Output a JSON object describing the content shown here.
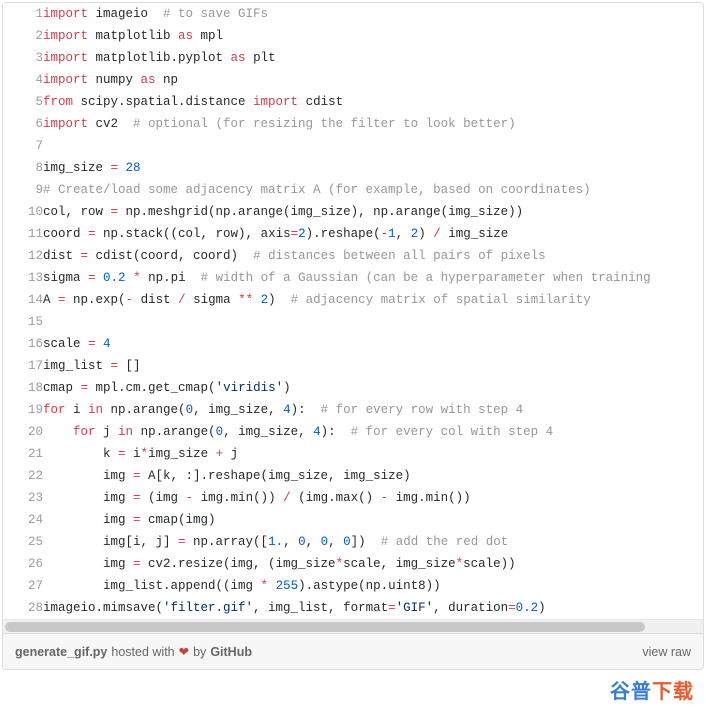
{
  "lines": [
    {
      "n": 1,
      "tokens": [
        [
          "kw",
          "import"
        ],
        [
          "pl",
          " imageio  "
        ],
        [
          "cm",
          "# to save GIFs"
        ]
      ]
    },
    {
      "n": 2,
      "tokens": [
        [
          "kw",
          "import"
        ],
        [
          "pl",
          " matplotlib "
        ],
        [
          "kw",
          "as"
        ],
        [
          "pl",
          " mpl"
        ]
      ]
    },
    {
      "n": 3,
      "tokens": [
        [
          "kw",
          "import"
        ],
        [
          "pl",
          " matplotlib.pyplot "
        ],
        [
          "kw",
          "as"
        ],
        [
          "pl",
          " plt"
        ]
      ]
    },
    {
      "n": 4,
      "tokens": [
        [
          "kw",
          "import"
        ],
        [
          "pl",
          " numpy "
        ],
        [
          "kw",
          "as"
        ],
        [
          "pl",
          " np"
        ]
      ]
    },
    {
      "n": 5,
      "tokens": [
        [
          "kw",
          "from"
        ],
        [
          "pl",
          " scipy.spatial.distance "
        ],
        [
          "kw",
          "import"
        ],
        [
          "pl",
          " cdist"
        ]
      ]
    },
    {
      "n": 6,
      "tokens": [
        [
          "kw",
          "import"
        ],
        [
          "pl",
          " cv2  "
        ],
        [
          "cm",
          "# optional (for resizing the filter to look better)"
        ]
      ]
    },
    {
      "n": 7,
      "tokens": [
        [
          "pl",
          ""
        ]
      ]
    },
    {
      "n": 8,
      "tokens": [
        [
          "pl",
          "img_size "
        ],
        [
          "op",
          "="
        ],
        [
          "pl",
          " "
        ],
        [
          "n",
          "28"
        ]
      ]
    },
    {
      "n": 9,
      "tokens": [
        [
          "cm",
          "# Create/load some adjacency matrix A (for example, based on coordinates)"
        ]
      ]
    },
    {
      "n": 10,
      "tokens": [
        [
          "pl",
          "col, row "
        ],
        [
          "op",
          "="
        ],
        [
          "pl",
          " np.meshgrid(np.arange(img_size), np.arange(img_size))"
        ]
      ]
    },
    {
      "n": 11,
      "tokens": [
        [
          "pl",
          "coord "
        ],
        [
          "op",
          "="
        ],
        [
          "pl",
          " np.stack((col, row), "
        ],
        [
          "id",
          "axis"
        ],
        [
          "op",
          "="
        ],
        [
          "n",
          "2"
        ],
        [
          "pl",
          ").reshape("
        ],
        [
          "op",
          "-"
        ],
        [
          "n",
          "1"
        ],
        [
          "pl",
          ", "
        ],
        [
          "n",
          "2"
        ],
        [
          "pl",
          ") "
        ],
        [
          "op",
          "/"
        ],
        [
          "pl",
          " img_size"
        ]
      ]
    },
    {
      "n": 12,
      "tokens": [
        [
          "pl",
          "dist "
        ],
        [
          "op",
          "="
        ],
        [
          "pl",
          " cdist(coord, coord)  "
        ],
        [
          "cm",
          "# distances between all pairs of pixels"
        ]
      ]
    },
    {
      "n": 13,
      "tokens": [
        [
          "pl",
          "sigma "
        ],
        [
          "op",
          "="
        ],
        [
          "pl",
          " "
        ],
        [
          "n",
          "0.2"
        ],
        [
          "pl",
          " "
        ],
        [
          "op",
          "*"
        ],
        [
          "pl",
          " np.pi  "
        ],
        [
          "cm",
          "# width of a Gaussian (can be a hyperparameter when training"
        ]
      ]
    },
    {
      "n": 14,
      "tokens": [
        [
          "pl",
          "A "
        ],
        [
          "op",
          "="
        ],
        [
          "pl",
          " np.exp("
        ],
        [
          "op",
          "-"
        ],
        [
          "pl",
          " dist "
        ],
        [
          "op",
          "/"
        ],
        [
          "pl",
          " sigma "
        ],
        [
          "op",
          "**"
        ],
        [
          "pl",
          " "
        ],
        [
          "n",
          "2"
        ],
        [
          "pl",
          ")  "
        ],
        [
          "cm",
          "# adjacency matrix of spatial similarity"
        ]
      ]
    },
    {
      "n": 15,
      "tokens": [
        [
          "pl",
          ""
        ]
      ]
    },
    {
      "n": 16,
      "tokens": [
        [
          "pl",
          "scale "
        ],
        [
          "op",
          "="
        ],
        [
          "pl",
          " "
        ],
        [
          "n",
          "4"
        ]
      ]
    },
    {
      "n": 17,
      "tokens": [
        [
          "pl",
          "img_list "
        ],
        [
          "op",
          "="
        ],
        [
          "pl",
          " []"
        ]
      ]
    },
    {
      "n": 18,
      "tokens": [
        [
          "pl",
          "cmap "
        ],
        [
          "op",
          "="
        ],
        [
          "pl",
          " mpl.cm.get_cmap("
        ],
        [
          "s",
          "'viridis'"
        ],
        [
          "pl",
          ")"
        ]
      ]
    },
    {
      "n": 19,
      "tokens": [
        [
          "kw",
          "for"
        ],
        [
          "pl",
          " i "
        ],
        [
          "kw",
          "in"
        ],
        [
          "pl",
          " np.arange("
        ],
        [
          "n",
          "0"
        ],
        [
          "pl",
          ", img_size, "
        ],
        [
          "n",
          "4"
        ],
        [
          "pl",
          "):  "
        ],
        [
          "cm",
          "# for every row with step 4"
        ]
      ]
    },
    {
      "n": 20,
      "tokens": [
        [
          "pl",
          "    "
        ],
        [
          "kw",
          "for"
        ],
        [
          "pl",
          " j "
        ],
        [
          "kw",
          "in"
        ],
        [
          "pl",
          " np.arange("
        ],
        [
          "n",
          "0"
        ],
        [
          "pl",
          ", img_size, "
        ],
        [
          "n",
          "4"
        ],
        [
          "pl",
          "):  "
        ],
        [
          "cm",
          "# for every col with step 4"
        ]
      ]
    },
    {
      "n": 21,
      "tokens": [
        [
          "pl",
          "        k "
        ],
        [
          "op",
          "="
        ],
        [
          "pl",
          " i"
        ],
        [
          "op",
          "*"
        ],
        [
          "pl",
          "img_size "
        ],
        [
          "op",
          "+"
        ],
        [
          "pl",
          " j"
        ]
      ]
    },
    {
      "n": 22,
      "tokens": [
        [
          "pl",
          "        img "
        ],
        [
          "op",
          "="
        ],
        [
          "pl",
          " A[k, :].reshape(img_size, img_size)"
        ]
      ]
    },
    {
      "n": 23,
      "tokens": [
        [
          "pl",
          "        img "
        ],
        [
          "op",
          "="
        ],
        [
          "pl",
          " (img "
        ],
        [
          "op",
          "-"
        ],
        [
          "pl",
          " img.min()) "
        ],
        [
          "op",
          "/"
        ],
        [
          "pl",
          " (img.max() "
        ],
        [
          "op",
          "-"
        ],
        [
          "pl",
          " img.min())"
        ]
      ]
    },
    {
      "n": 24,
      "tokens": [
        [
          "pl",
          "        img "
        ],
        [
          "op",
          "="
        ],
        [
          "pl",
          " cmap(img)"
        ]
      ]
    },
    {
      "n": 25,
      "tokens": [
        [
          "pl",
          "        img[i, j] "
        ],
        [
          "op",
          "="
        ],
        [
          "pl",
          " np.array(["
        ],
        [
          "n",
          "1."
        ],
        [
          "pl",
          ", "
        ],
        [
          "n",
          "0"
        ],
        [
          "pl",
          ", "
        ],
        [
          "n",
          "0"
        ],
        [
          "pl",
          ", "
        ],
        [
          "n",
          "0"
        ],
        [
          "pl",
          "])  "
        ],
        [
          "cm",
          "# add the red dot"
        ]
      ]
    },
    {
      "n": 26,
      "tokens": [
        [
          "pl",
          "        img "
        ],
        [
          "op",
          "="
        ],
        [
          "pl",
          " cv2.resize(img, (img_size"
        ],
        [
          "op",
          "*"
        ],
        [
          "pl",
          "scale, img_size"
        ],
        [
          "op",
          "*"
        ],
        [
          "pl",
          "scale))"
        ]
      ]
    },
    {
      "n": 27,
      "tokens": [
        [
          "pl",
          "        img_list.append((img "
        ],
        [
          "op",
          "*"
        ],
        [
          "pl",
          " "
        ],
        [
          "n",
          "255"
        ],
        [
          "pl",
          ").astype(np.uint8))"
        ]
      ]
    },
    {
      "n": 28,
      "tokens": [
        [
          "pl",
          "imageio.mimsave("
        ],
        [
          "s",
          "'filter.gif'"
        ],
        [
          "pl",
          ", img_list, "
        ],
        [
          "id",
          "format"
        ],
        [
          "op",
          "="
        ],
        [
          "s",
          "'GIF'"
        ],
        [
          "pl",
          ", "
        ],
        [
          "id",
          "duration"
        ],
        [
          "op",
          "="
        ],
        [
          "n",
          "0.2"
        ],
        [
          "pl",
          ")"
        ]
      ]
    }
  ],
  "meta": {
    "filename": "generate_gif.py",
    "hosted_with": "hosted with",
    "by": "by",
    "github": "GitHub",
    "view_raw": "view raw",
    "heart": "❤"
  },
  "watermark": "谷普下载"
}
